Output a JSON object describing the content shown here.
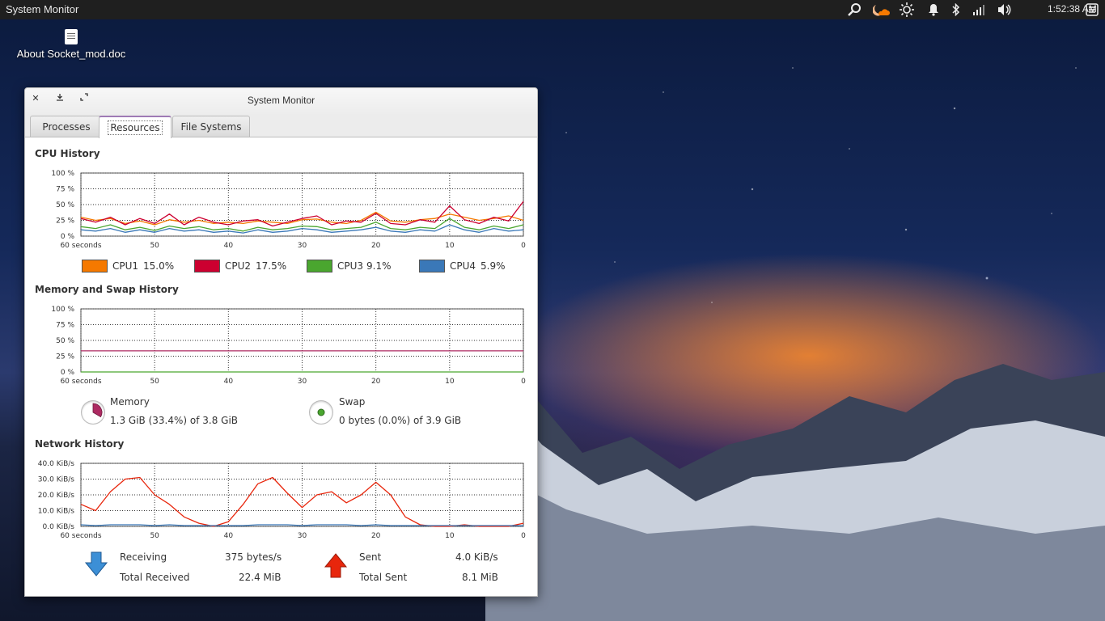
{
  "panel": {
    "app_name": "System Monitor",
    "clock": "1:52:38 AM",
    "indicators": [
      "search-icon",
      "weather-icon",
      "brightness-icon",
      "notification-bell-icon",
      "bluetooth-icon",
      "network-signal-icon",
      "volume-icon",
      "menu-icon"
    ]
  },
  "desktop": {
    "icon_label": "About Socket_mod.doc"
  },
  "window": {
    "title": "System Monitor",
    "tabs": [
      {
        "label": "Processes",
        "active": false
      },
      {
        "label": "Resources",
        "active": true
      },
      {
        "label": "File Systems",
        "active": false
      }
    ]
  },
  "cpu": {
    "title": "CPU History",
    "y_ticks": [
      "100 %",
      "75 %",
      "50 %",
      "25 %",
      "0 %"
    ],
    "x_ticks": [
      "60 seconds",
      "50",
      "40",
      "30",
      "20",
      "10",
      "0"
    ],
    "legend": [
      {
        "label": "CPU1",
        "value": "15.0%",
        "color": "#f57900"
      },
      {
        "label": "CPU2",
        "value": "17.5%",
        "color": "#cc0030"
      },
      {
        "label": "CPU3",
        "value": "9.1%",
        "color": "#4aa62f"
      },
      {
        "label": "CPU4",
        "value": "5.9%",
        "color": "#3a78b8"
      }
    ]
  },
  "memory": {
    "title": "Memory and Swap History",
    "y_ticks": [
      "100 %",
      "75 %",
      "50 %",
      "25 %",
      "0 %"
    ],
    "x_ticks": [
      "60 seconds",
      "50",
      "40",
      "30",
      "20",
      "10",
      "0"
    ],
    "memory_label": "Memory",
    "memory_value": "1.3 GiB (33.4%) of 3.8 GiB",
    "memory_percent": 33.4,
    "memory_color": "#ad2a62",
    "swap_label": "Swap",
    "swap_value": "0 bytes (0.0%) of 3.9 GiB",
    "swap_percent": 0,
    "swap_color": "#4aa62f"
  },
  "network": {
    "title": "Network History",
    "y_ticks": [
      "40.0 KiB/s",
      "30.0 KiB/s",
      "20.0 KiB/s",
      "10.0 KiB/s",
      "0.0 KiB/s"
    ],
    "x_ticks": [
      "60 seconds",
      "50",
      "40",
      "30",
      "20",
      "10",
      "0"
    ],
    "receiving_label": "Receiving",
    "receiving_value": "375 bytes/s",
    "total_received_label": "Total Received",
    "total_received_value": "22.4 MiB",
    "sent_label": "Sent",
    "sent_value": "4.0 KiB/s",
    "total_sent_label": "Total Sent",
    "total_sent_value": "8.1 MiB",
    "receiving_color": "#3a78b8",
    "sent_color": "#e8260c"
  },
  "chart_data": [
    {
      "type": "line",
      "title": "CPU History",
      "xlabel": "60 seconds",
      "ylabel": "",
      "x": [
        60,
        58,
        56,
        54,
        52,
        50,
        48,
        46,
        44,
        42,
        40,
        38,
        36,
        34,
        32,
        30,
        28,
        26,
        24,
        22,
        20,
        18,
        16,
        14,
        12,
        10,
        8,
        6,
        4,
        2,
        0
      ],
      "ylim": [
        0,
        100
      ],
      "series": [
        {
          "name": "CPU1",
          "values": [
            30,
            25,
            28,
            20,
            24,
            18,
            26,
            22,
            25,
            20,
            22,
            20,
            24,
            22,
            20,
            26,
            27,
            22,
            20,
            25,
            38,
            24,
            22,
            26,
            28,
            35,
            30,
            25,
            28,
            32,
            25
          ]
        },
        {
          "name": "CPU2",
          "values": [
            28,
            22,
            30,
            18,
            28,
            20,
            35,
            18,
            30,
            22,
            18,
            24,
            26,
            16,
            22,
            28,
            32,
            18,
            24,
            22,
            36,
            20,
            18,
            26,
            22,
            48,
            26,
            20,
            30,
            24,
            55
          ]
        },
        {
          "name": "CPU3",
          "values": [
            15,
            12,
            18,
            10,
            14,
            9,
            16,
            12,
            15,
            10,
            12,
            8,
            14,
            10,
            12,
            16,
            15,
            10,
            12,
            14,
            22,
            12,
            10,
            14,
            12,
            28,
            14,
            10,
            16,
            12,
            18
          ]
        },
        {
          "name": "CPU4",
          "values": [
            10,
            8,
            12,
            6,
            10,
            6,
            12,
            8,
            10,
            6,
            8,
            5,
            10,
            6,
            8,
            12,
            10,
            6,
            8,
            10,
            14,
            8,
            6,
            10,
            8,
            18,
            10,
            6,
            12,
            8,
            10
          ]
        }
      ]
    },
    {
      "type": "line",
      "title": "Memory and Swap History",
      "xlabel": "60 seconds",
      "ylabel": "",
      "x": [
        60,
        0
      ],
      "ylim": [
        0,
        100
      ],
      "series": [
        {
          "name": "Memory",
          "values": [
            33.4,
            33.4
          ]
        },
        {
          "name": "Swap",
          "values": [
            0,
            0
          ]
        }
      ]
    },
    {
      "type": "line",
      "title": "Network History",
      "xlabel": "60 seconds",
      "ylabel": "KiB/s",
      "x": [
        60,
        58,
        56,
        54,
        52,
        50,
        48,
        46,
        44,
        42,
        40,
        38,
        36,
        34,
        32,
        30,
        28,
        26,
        24,
        22,
        20,
        18,
        16,
        14,
        12,
        10,
        8,
        6,
        4,
        2,
        0
      ],
      "ylim": [
        0,
        40
      ],
      "series": [
        {
          "name": "Sent",
          "values": [
            14,
            10,
            22,
            30,
            31,
            20,
            14,
            6,
            2,
            0,
            3,
            14,
            27,
            31,
            21,
            12,
            20,
            22,
            15,
            20,
            28,
            20,
            6,
            1,
            0,
            0,
            1,
            0,
            0,
            0,
            2
          ]
        },
        {
          "name": "Receiving",
          "values": [
            1,
            0.5,
            1,
            1,
            1,
            0.5,
            1,
            0.5,
            0.5,
            0.5,
            0.5,
            0.5,
            1,
            1,
            1,
            0.5,
            1,
            1,
            1,
            0.5,
            1,
            0.5,
            0.5,
            0.5,
            0.5,
            0.5,
            0.5,
            0.5,
            0.5,
            0.5,
            0.4
          ]
        }
      ]
    }
  ]
}
